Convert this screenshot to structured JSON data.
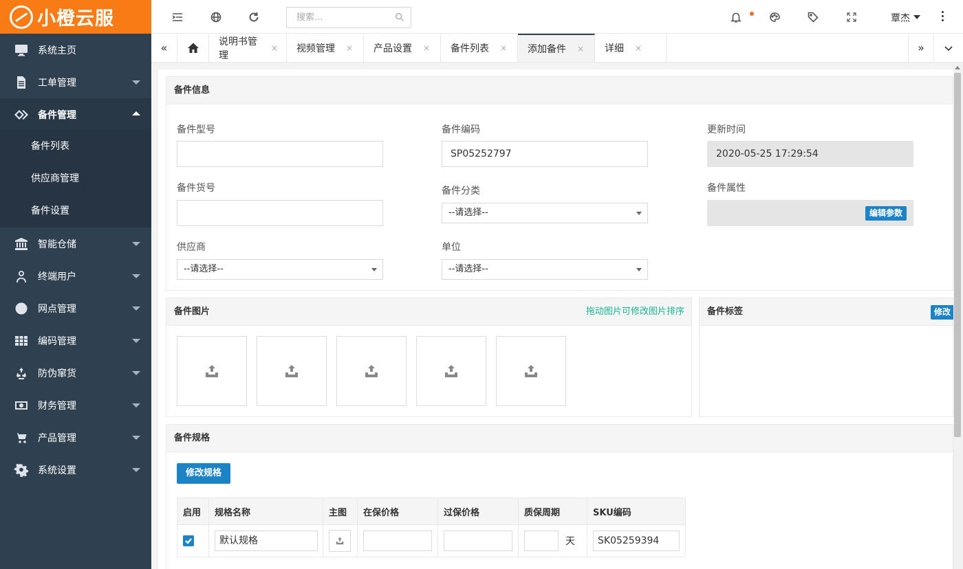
{
  "app": {
    "logo_text": "小橙云服",
    "brand_color": "#f87b16",
    "sidebar_color": "#2f4050",
    "accent_color": "#1c84c6"
  },
  "sidebar": {
    "items": [
      {
        "label": "系统主页",
        "icon": "monitor-icon"
      },
      {
        "label": "工单管理",
        "icon": "document-icon"
      },
      {
        "label": "备件管理",
        "icon": "diamond-icon",
        "expanded": true,
        "children": [
          "备件列表",
          "供应商管理",
          "备件设置"
        ]
      },
      {
        "label": "智能仓储",
        "icon": "bank-icon"
      },
      {
        "label": "终端用户",
        "icon": "user-icon"
      },
      {
        "label": "网点管理",
        "icon": "globe-icon"
      },
      {
        "label": "编码管理",
        "icon": "grid-icon"
      },
      {
        "label": "防伪窜货",
        "icon": "recycle-icon"
      },
      {
        "label": "财务管理",
        "icon": "money-icon"
      },
      {
        "label": "产品管理",
        "icon": "cart-icon"
      },
      {
        "label": "系统设置",
        "icon": "gear-icon"
      }
    ]
  },
  "topbar": {
    "search_placeholder": "搜索...",
    "username": "覃杰"
  },
  "tabs": [
    {
      "label": "说明书管理"
    },
    {
      "label": "视频管理"
    },
    {
      "label": "产品设置"
    },
    {
      "label": "备件列表"
    },
    {
      "label": "添加备件",
      "active": true
    },
    {
      "label": "详细"
    }
  ],
  "tab_close_glyph": "×",
  "info_panel": {
    "title": "备件信息",
    "model_label": "备件型号",
    "model_value": "",
    "code_label": "备件编码",
    "code_value": "SP05252797",
    "updated_label": "更新时间",
    "updated_value": "2020-05-25 17:29:54",
    "sku_label": "备件货号",
    "sku_value": "",
    "category_label": "备件分类",
    "category_value": "--请选择--",
    "attr_label": "备件属性",
    "edit_params_button": "编辑参数",
    "supplier_label": "供应商",
    "supplier_value": "--请选择--",
    "unit_label": "单位",
    "unit_value": "--请选择--"
  },
  "images_panel": {
    "title": "备件图片",
    "hint": "拖动图片可修改图片排序",
    "hint_color": "#1ab394",
    "slots": 5
  },
  "tags_panel": {
    "title": "备件标签",
    "edit_button": "修改"
  },
  "spec_panel": {
    "title": "备件规格",
    "edit_button": "修改规格",
    "columns": [
      "启用",
      "规格名称",
      "主图",
      "在保价格",
      "过保价格",
      "质保周期",
      "SKU编码"
    ],
    "rows": [
      {
        "enabled": true,
        "name": "默认规格",
        "in_warranty_price": "",
        "out_warranty_price": "",
        "warranty_period": "",
        "period_unit": "天",
        "sku": "SK05259394"
      }
    ]
  }
}
